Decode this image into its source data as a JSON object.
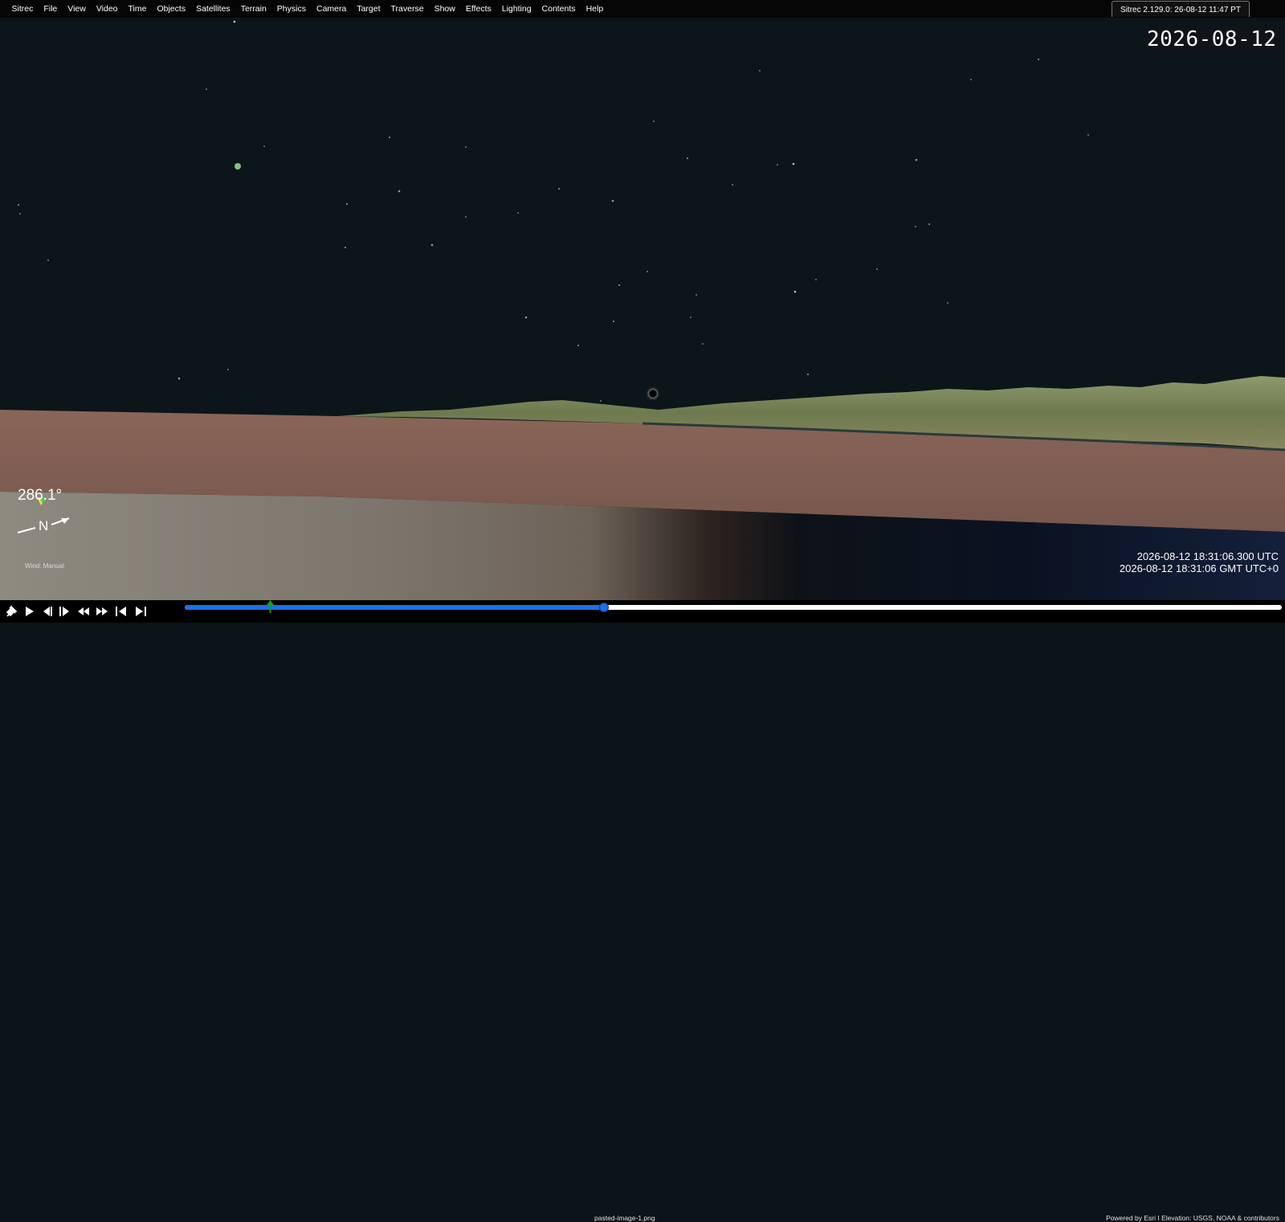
{
  "app": {
    "menu": [
      "Sitrec",
      "File",
      "View",
      "Video",
      "Time",
      "Objects",
      "Satellites",
      "Terrain",
      "Physics",
      "Camera",
      "Target",
      "Traverse",
      "Show",
      "Effects",
      "Lighting",
      "Contents",
      "Help"
    ],
    "version_tab": "Sitrec 2.129.0: 26-08-12 11:47 PT"
  },
  "overlay": {
    "date": "2026-08-12",
    "heading": "286.1°",
    "north_label": "N",
    "wind_label": "Wind: Manual",
    "utc_time": "2026-08-12 18:31:06.300 UTC",
    "gmt_time": "2026-08-12 18:31:06 GMT UTC+0"
  },
  "playback": {
    "buttons": [
      "pin-icon",
      "play-icon",
      "step-back-icon",
      "step-forward-icon",
      "rewind-icon",
      "fast-forward-icon",
      "skip-start-icon",
      "skip-end-icon"
    ],
    "progress_fraction": 0.382,
    "filename": "pasted-image-1.png",
    "attribution": "Powered by Esri I Elevation: USGS, NOAA & contributors"
  },
  "colors": {
    "accent": "#1e6fe6",
    "sky": "#0c1519",
    "ground": "#7c5b50"
  }
}
